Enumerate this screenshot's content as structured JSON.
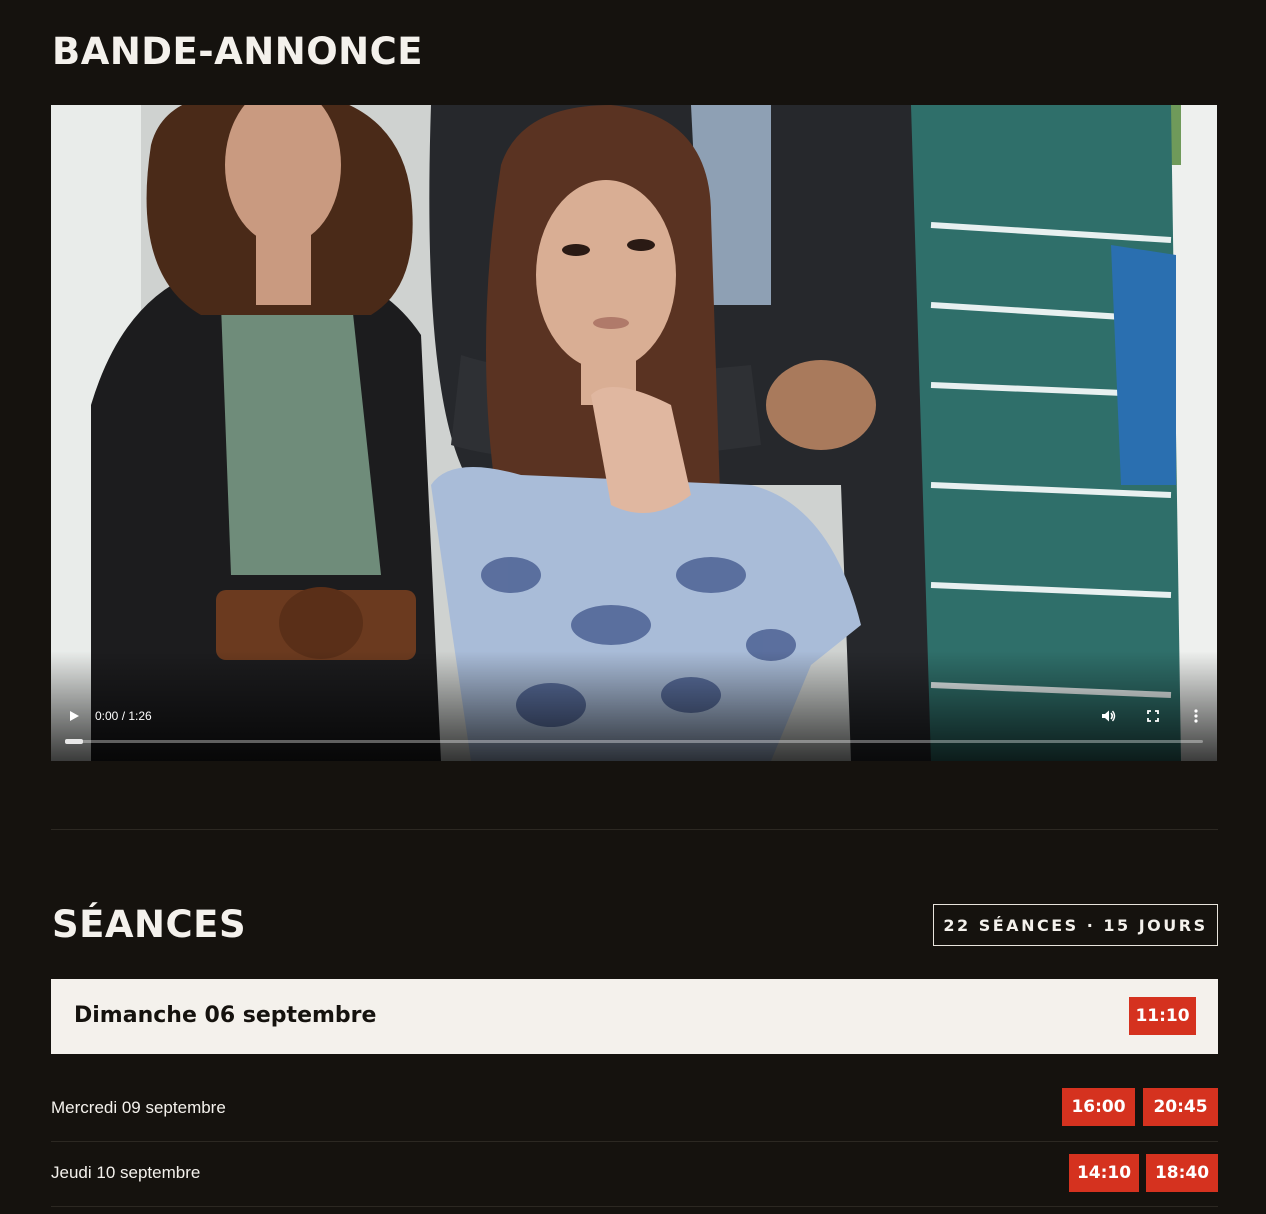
{
  "trailer": {
    "heading": "BANDE-ANNONCE",
    "player": {
      "time_display": "0:00 / 1:26",
      "progress": 0.0,
      "controls": [
        "play-icon",
        "volume-icon",
        "fullscreen-icon",
        "more-options-icon"
      ]
    }
  },
  "seances": {
    "heading": "SÉANCES",
    "count_badge": "22 SÉANCES · 15 JOURS",
    "days": [
      {
        "label": "Dimanche 06 septembre",
        "times": [
          "11:10"
        ],
        "featured": true
      },
      {
        "label": "Mercredi 09 septembre",
        "times": [
          "16:00",
          "20:45"
        ],
        "featured": false
      },
      {
        "label": "Jeudi 10 septembre",
        "times": [
          "14:10",
          "18:40"
        ],
        "featured": false
      }
    ]
  },
  "colors": {
    "background": "#15120e",
    "text": "#f4f1ec",
    "accent_red": "#d5321f",
    "featured_row": "#f4f1ec"
  }
}
